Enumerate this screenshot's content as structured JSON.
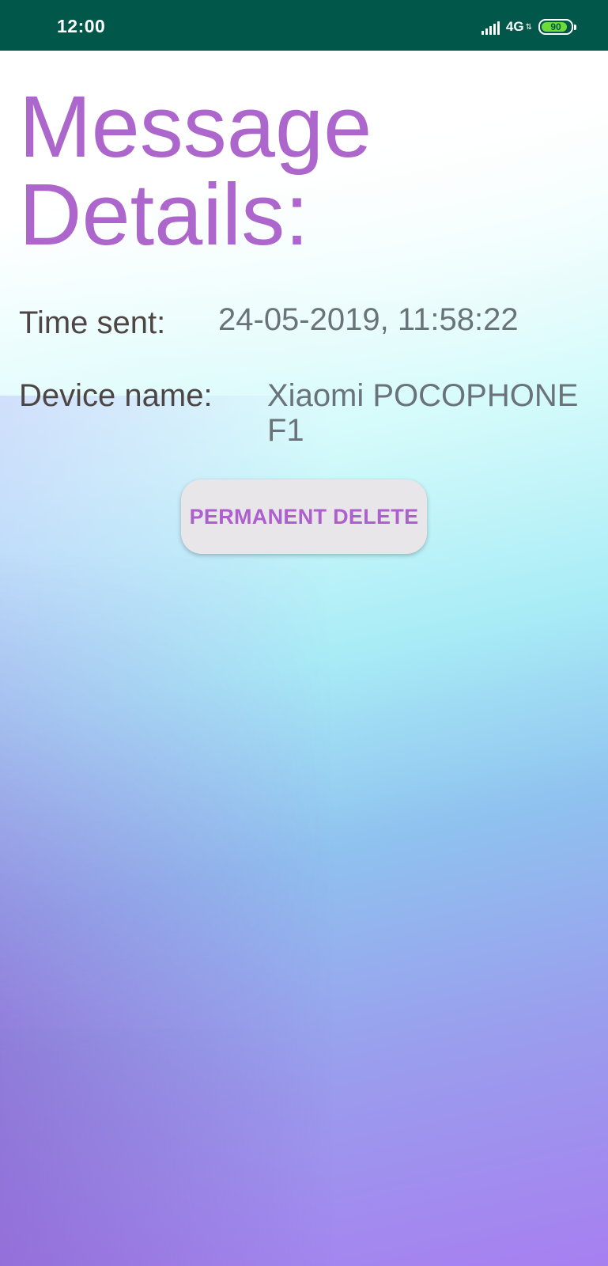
{
  "status_bar": {
    "time": "12:00",
    "network": "4G",
    "network_arrows": "⇅",
    "battery_level": "90",
    "battery_percent": 90,
    "background_color": "#02574b"
  },
  "details": {
    "title": "Message Details:",
    "time_sent_label": "Time sent:",
    "time_sent_value": "24-05-2019, 11:58:22",
    "device_name_label": "Device name:",
    "device_name_value": "Xiaomi POCOPHONE F1"
  },
  "actions": {
    "delete_label": "PERMANENT DELETE"
  },
  "colors": {
    "accent": "#ac66cc",
    "label_text": "#4e4545",
    "value_text": "#6a7379",
    "button_bg": "#e8e6e8"
  }
}
